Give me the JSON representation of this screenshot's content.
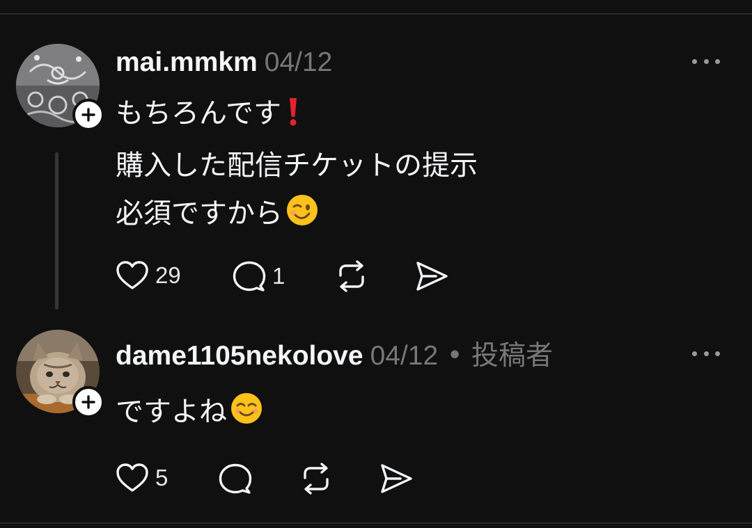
{
  "posts": [
    {
      "username": "mai.mmkm",
      "date": "04/12",
      "role": "",
      "lines": [
        "もちろんです",
        "購入した配信チケットの提示",
        "必須ですから"
      ],
      "line_emojis": [
        "red-exclamation-mark",
        "",
        "winking-face"
      ],
      "likes": "29",
      "replies": "1",
      "avatar": "lace-pattern-avatar"
    },
    {
      "username": "dame1105nekolove",
      "date": "04/12",
      "role": "• 投稿者",
      "lines": [
        "ですよね"
      ],
      "line_emojis": [
        "smiling-face"
      ],
      "likes": "5",
      "replies": "",
      "avatar": "cat-photo-avatar"
    }
  ],
  "colors": {
    "background": "#101010",
    "text": "#f3f5f7",
    "muted": "#777777",
    "thread_line": "#363636"
  },
  "icons": [
    "heart-icon",
    "comment-icon",
    "repost-icon",
    "share-icon",
    "more-icon",
    "follow-plus-icon"
  ]
}
